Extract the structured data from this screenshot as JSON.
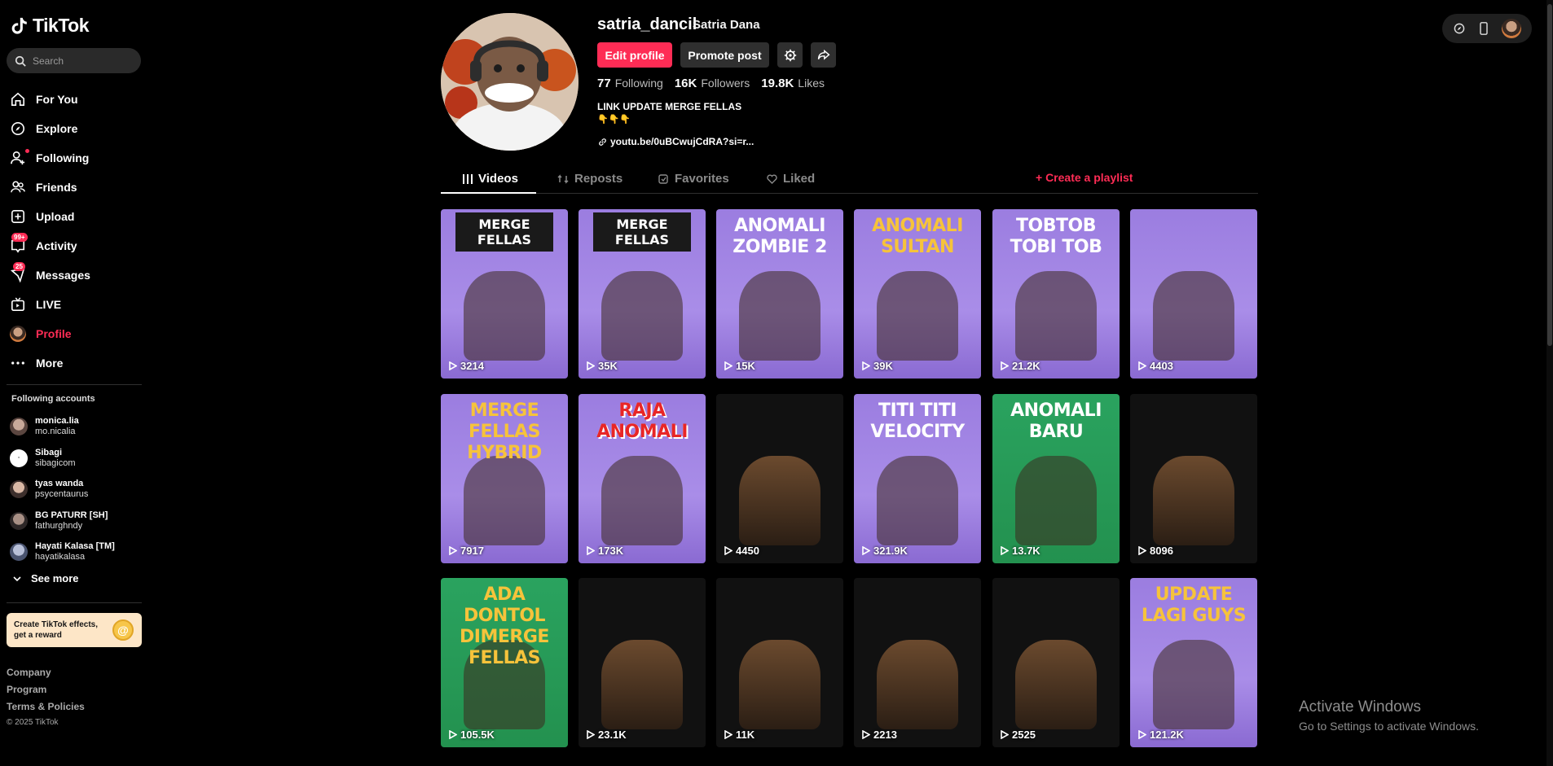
{
  "app": {
    "logo_text": "TikTok"
  },
  "search": {
    "placeholder": "Search"
  },
  "nav": [
    {
      "label": "For You",
      "icon": "home-icon"
    },
    {
      "label": "Explore",
      "icon": "compass-icon"
    },
    {
      "label": "Following",
      "icon": "following-icon"
    },
    {
      "label": "Friends",
      "icon": "friends-icon"
    },
    {
      "label": "Upload",
      "icon": "upload-icon"
    },
    {
      "label": "Activity",
      "icon": "activity-icon",
      "badge": "99+"
    },
    {
      "label": "Messages",
      "icon": "messages-icon",
      "badge": "25"
    },
    {
      "label": "LIVE",
      "icon": "live-icon"
    },
    {
      "label": "Profile",
      "icon": "profile-avatar"
    },
    {
      "label": "More",
      "icon": "more-icon"
    }
  ],
  "following_accounts": {
    "title": "Following accounts",
    "items": [
      {
        "name": "monica.lia",
        "username": "mo.nicalia"
      },
      {
        "name": "Sibagi",
        "username": "sibagicom"
      },
      {
        "name": "tyas wanda",
        "username": "psycentaurus"
      },
      {
        "name": "BG PATURR [SH]",
        "username": "fathurghndy"
      },
      {
        "name": "Hayati Kalasa [TM]",
        "username": "hayatikalasa"
      }
    ],
    "see_more": "See more"
  },
  "effects_banner": {
    "line1": "Create TikTok effects,",
    "line2": "get a reward"
  },
  "footer": {
    "links": [
      "Company",
      "Program",
      "Terms & Policies"
    ],
    "copyright": "© 2025 TikTok"
  },
  "profile": {
    "username": "satria_dancil",
    "display_name": "Satria Dana",
    "edit_label": "Edit profile",
    "promote_label": "Promote post",
    "stats": {
      "following": "77",
      "following_label": "Following",
      "followers": "16K",
      "followers_label": "Followers",
      "likes": "19.8K",
      "likes_label": "Likes"
    },
    "bio": "LINK UPDATE MERGE FELLAS",
    "bio_emoji": "👇👇👇",
    "link": "youtu.be/0uBCwujCdRA?si=r..."
  },
  "tabs": [
    {
      "label": "Videos",
      "icon": "grid-icon"
    },
    {
      "label": "Reposts",
      "icon": "repost-icon"
    },
    {
      "label": "Favorites",
      "icon": "favorites-icon"
    },
    {
      "label": "Liked",
      "icon": "liked-icon"
    }
  ],
  "create_playlist": "+ Create a playlist",
  "videos": [
    {
      "views": "3214",
      "title": "MERGE FELLAS"
    },
    {
      "views": "35K",
      "title": "MERGE FELLAS"
    },
    {
      "views": "15K",
      "title": "ANOMALI ZOMBIE 2"
    },
    {
      "views": "39K",
      "title": "ANOMALI SULTAN"
    },
    {
      "views": "21.2K",
      "title": "TOBTOB TOBI TOB"
    },
    {
      "views": "4403",
      "title": ""
    },
    {
      "views": "7917",
      "title": "MERGE FELLAS HYBRID"
    },
    {
      "views": "173K",
      "title": "RAJA ANOMALI"
    },
    {
      "views": "4450",
      "title": ""
    },
    {
      "views": "321.9K",
      "title": "TITI TITI VELOCITY"
    },
    {
      "views": "13.7K",
      "title": "ANOMALI BARU"
    },
    {
      "views": "8096",
      "title": ""
    },
    {
      "views": "105.5K",
      "title": "ADA DONTOL DIMERGE FELLAS"
    },
    {
      "views": "23.1K",
      "title": ""
    },
    {
      "views": "11K",
      "title": ""
    },
    {
      "views": "2213",
      "title": ""
    },
    {
      "views": "2525",
      "title": ""
    },
    {
      "views": "121.2K",
      "title": "UPDATE LAGI GUYS"
    }
  ],
  "watermark": {
    "line1": "Activate Windows",
    "line2": "Go to Settings to activate Windows."
  },
  "colors": {
    "accent": "#fe2c55",
    "purple": "#a08ae3",
    "green": "#25995a"
  }
}
